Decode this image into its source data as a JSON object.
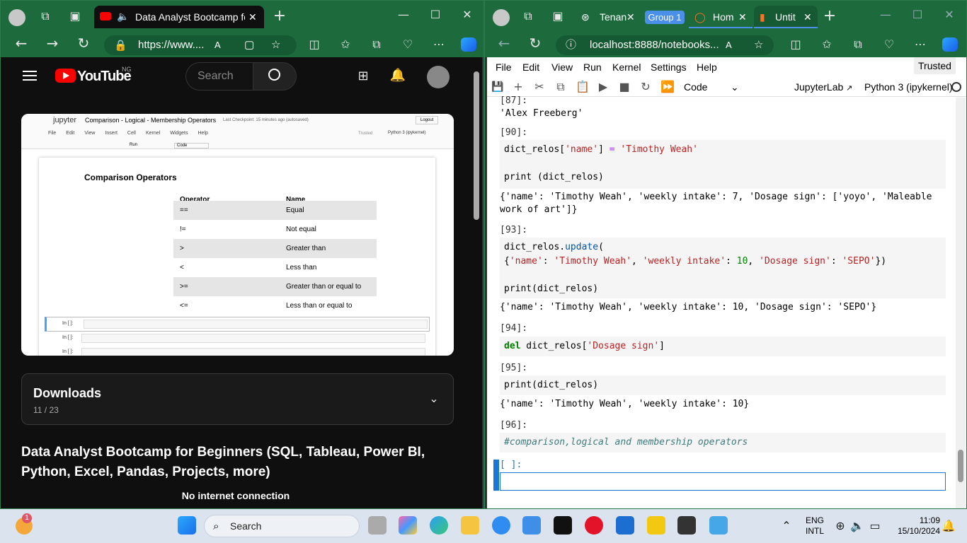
{
  "left": {
    "tab_title": "Data Analyst Bootcamp for B",
    "url": "https://www....",
    "search_placeholder": "Search",
    "country": "NG",
    "logo": "YouTube",
    "thumb": {
      "jupyter": "jupyter",
      "nb_title": "Comparison - Logical - Membership Operators",
      "checkpoint": "Last Checkpoint: 15 minutes ago  (autosaved)",
      "logout": "Logout",
      "menu": [
        "File",
        "Edit",
        "View",
        "Insert",
        "Cell",
        "Kernel",
        "Widgets",
        "Help"
      ],
      "trusted": "Trusted",
      "kernel": "Python 3 (ipykernel)",
      "run": "Run",
      "code": "Code",
      "heading": "Comparison Operators",
      "col1": "Operator",
      "col2": "Name",
      "rows": [
        [
          "==",
          "Equal"
        ],
        [
          "!=",
          "Not equal"
        ],
        [
          ">",
          "Greater than"
        ],
        [
          "<",
          "Less than"
        ],
        [
          ">=",
          "Greater than or equal to"
        ],
        [
          "<=",
          "Less than or equal to"
        ]
      ],
      "prompt": "In [ ]:"
    },
    "downloads_title": "Downloads",
    "downloads_count": "11 / 23",
    "video_title": "Data Analyst Bootcamp for Beginners (SQL, Tableau, Power BI, Python, Excel, Pandas, Projects, more)",
    "status": "No internet connection"
  },
  "right": {
    "tabs": [
      "Tenan",
      "Group 1",
      "Hom",
      "Untit"
    ],
    "url": "localhost:8888/notebooks...",
    "trusted": "Trusted",
    "menu": [
      "File",
      "Edit",
      "View",
      "Run",
      "Kernel",
      "Settings",
      "Help"
    ],
    "cell_type": "Code",
    "jupyterlab": "JupyterLab",
    "kernel": "Python 3 (ipykernel)",
    "p87": "[87]:",
    "o87": "'Alex Freeberg'",
    "p90": "[90]:",
    "o90": "{'name': 'Timothy Weah', 'weekly intake': 7, 'Dosage sign': ['yoyo', 'Maleable work of art']}",
    "p93": "[93]:",
    "o93": "{'name': 'Timothy Weah', 'weekly intake': 10, 'Dosage sign': 'SEPO'}",
    "p94": "[94]:",
    "p95": "[95]:",
    "c95": "print(dict_relos)",
    "o95": "{'name': 'Timothy Weah', 'weekly intake': 10}",
    "p96": "[96]:",
    "c96": "#comparison,logical and membership operators",
    "pnew": "[ ]:"
  },
  "taskbar": {
    "search": "Search",
    "lang1": "ENG",
    "lang2": "INTL",
    "time": "11:09",
    "date": "15/10/2024",
    "badge": "1"
  }
}
